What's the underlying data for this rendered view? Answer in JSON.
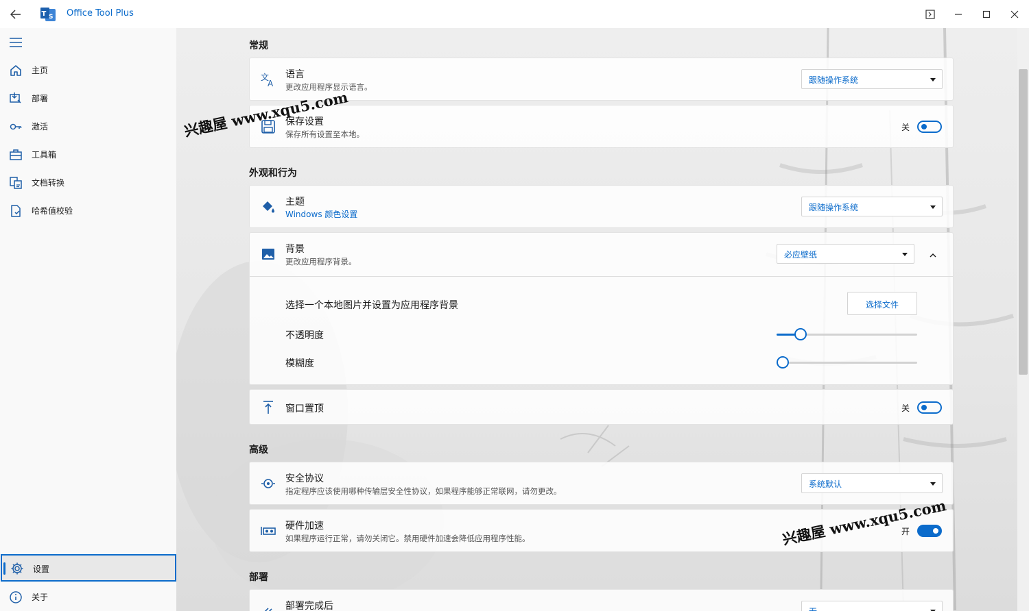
{
  "app": {
    "title": "Office Tool Plus"
  },
  "sidebar": {
    "items": [
      {
        "label": "主页",
        "icon": "home-icon"
      },
      {
        "label": "部署",
        "icon": "deploy-icon"
      },
      {
        "label": "激活",
        "icon": "key-icon"
      },
      {
        "label": "工具箱",
        "icon": "toolbox-icon"
      },
      {
        "label": "文档转换",
        "icon": "document-convert-icon"
      },
      {
        "label": "哈希值校验",
        "icon": "hash-check-icon"
      }
    ],
    "bottom_items": [
      {
        "label": "设置",
        "icon": "gear-icon",
        "selected": true
      },
      {
        "label": "关于",
        "icon": "info-icon"
      }
    ]
  },
  "sections": {
    "general": "常规",
    "appearance": "外观和行为",
    "advanced": "高级",
    "deploy": "部署"
  },
  "settings": {
    "language": {
      "title": "语言",
      "desc": "更改应用程序显示语言。",
      "value": "跟随操作系统"
    },
    "save_settings": {
      "title": "保存设置",
      "desc": "保存所有设置至本地。",
      "toggle_label": "关",
      "on": false
    },
    "theme": {
      "title": "主题",
      "link": "Windows 颜色设置",
      "value": "跟随操作系统"
    },
    "background": {
      "title": "背景",
      "desc": "更改应用程序背景。",
      "value": "必应壁纸",
      "select_local_label": "选择一个本地图片并设置为应用程序背景",
      "select_file_button": "选择文件",
      "opacity_label": "不透明度",
      "opacity_value": 0.14,
      "blur_label": "模糊度",
      "blur_value": 0
    },
    "topmost": {
      "title": "窗口置顶",
      "toggle_label": "关",
      "on": false
    },
    "security_protocol": {
      "title": "安全协议",
      "desc": "指定程序应该使用哪种传输层安全性协议，如果程序能够正常联网，请勿更改。",
      "value": "系统默认"
    },
    "hardware_acceleration": {
      "title": "硬件加速",
      "desc": "如果程序运行正常，请勿关闭它。禁用硬件加速会降低应用程序性能。",
      "toggle_label": "开",
      "on": true
    },
    "after_deploy": {
      "title": "部署完成后",
      "value": "无"
    }
  },
  "watermarks": [
    "兴趣屋 www.xqu5.com",
    "兴趣屋 www.xqu5.com"
  ],
  "colors": {
    "accent": "#0b6bcb",
    "sidebar_bg": "#f9f9f9",
    "selected_bg": "#e8e8e8"
  }
}
